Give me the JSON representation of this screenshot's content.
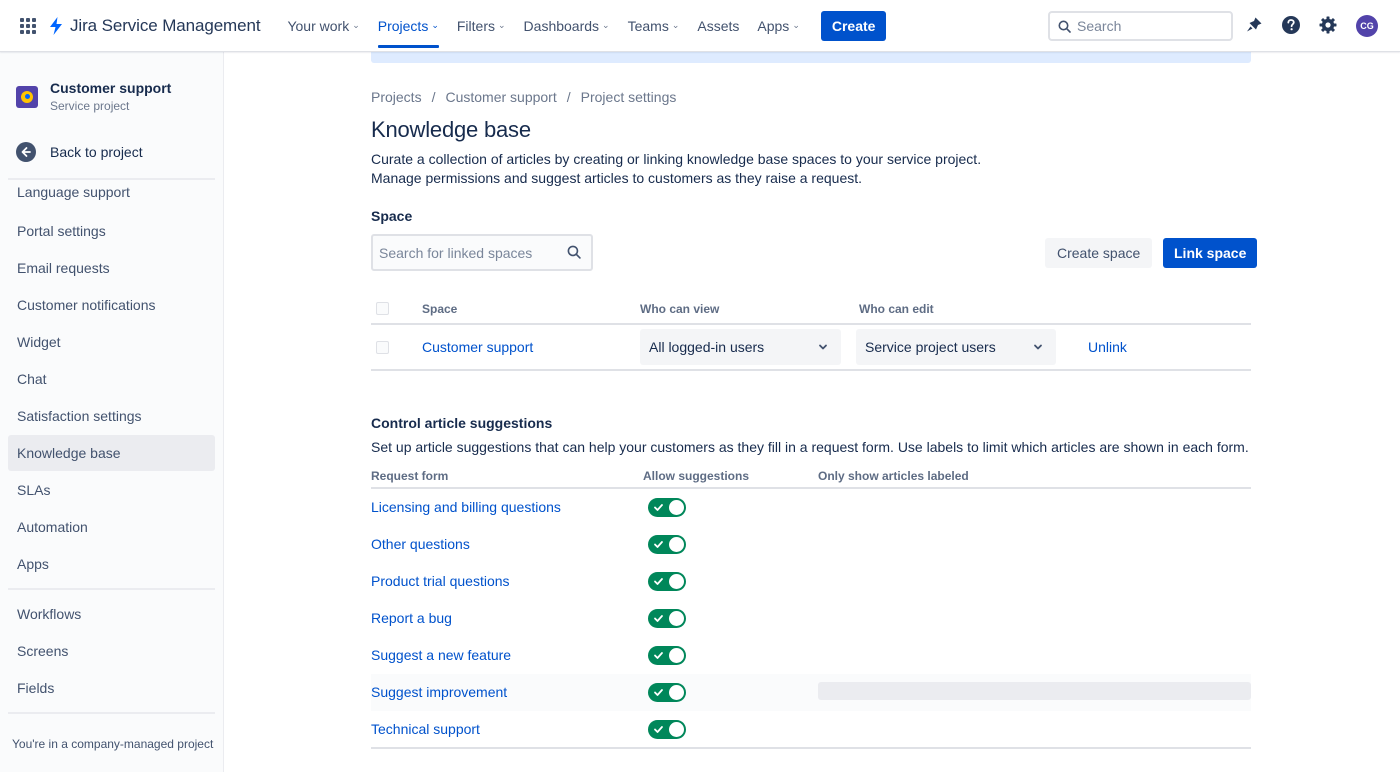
{
  "topnav": {
    "product": "Jira Service Management",
    "items": [
      {
        "label": "Your work",
        "chevron": true
      },
      {
        "label": "Projects",
        "chevron": true,
        "active": true
      },
      {
        "label": "Filters",
        "chevron": true
      },
      {
        "label": "Dashboards",
        "chevron": true
      },
      {
        "label": "Teams",
        "chevron": true
      },
      {
        "label": "Assets",
        "chevron": false
      },
      {
        "label": "Apps",
        "chevron": true
      }
    ],
    "create_label": "Create",
    "search_placeholder": "Search",
    "avatar_initials": "CG",
    "icons": [
      "app-switcher-icon",
      "notifications-icon",
      "help-icon",
      "settings-icon"
    ]
  },
  "sidebar": {
    "project_name": "Customer support",
    "project_type": "Service project",
    "back_label": "Back to project",
    "items": [
      "Language support",
      "Portal settings",
      "Email requests",
      "Customer notifications",
      "Widget",
      "Chat",
      "Satisfaction settings",
      "Knowledge base",
      "SLAs",
      "Automation",
      "Apps",
      "Workflows",
      "Screens",
      "Fields"
    ],
    "active_item": "Knowledge base",
    "footer": "You're in a company-managed project"
  },
  "breadcrumbs": [
    "Projects",
    "Customer support",
    "Project settings"
  ],
  "page": {
    "title": "Knowledge base",
    "description_line1": "Curate a collection of articles by creating or linking knowledge base spaces to your service project.",
    "description_line2": "Manage permissions and suggest articles to customers as they raise a request."
  },
  "space_section": {
    "label": "Space",
    "search_placeholder": "Search for linked spaces",
    "create_label": "Create space",
    "link_label": "Link space",
    "columns": [
      "Space",
      "Who can view",
      "Who can edit"
    ],
    "rows": [
      {
        "space": "Customer support",
        "view": "All logged-in users",
        "edit": "Service project users",
        "action": "Unlink"
      }
    ]
  },
  "suggestions": {
    "title": "Control article suggestions",
    "description": "Set up article suggestions that can help your customers as they fill in a request form. Use labels to limit which articles are shown in each form.",
    "columns": [
      "Request form",
      "Allow suggestions",
      "Only show articles labeled"
    ],
    "rows": [
      {
        "form": "Licensing and billing questions",
        "allowed": true
      },
      {
        "form": "Other questions",
        "allowed": true
      },
      {
        "form": "Product trial questions",
        "allowed": true
      },
      {
        "form": "Report a bug",
        "allowed": true
      },
      {
        "form": "Suggest a new feature",
        "allowed": true
      },
      {
        "form": "Suggest improvement",
        "allowed": true
      },
      {
        "form": "Technical support",
        "allowed": true
      }
    ]
  },
  "colors": {
    "brand": "#0052cc",
    "toggle_on": "#00875a",
    "text": "#172b4d",
    "sidebar_bg": "#fafbfc"
  }
}
